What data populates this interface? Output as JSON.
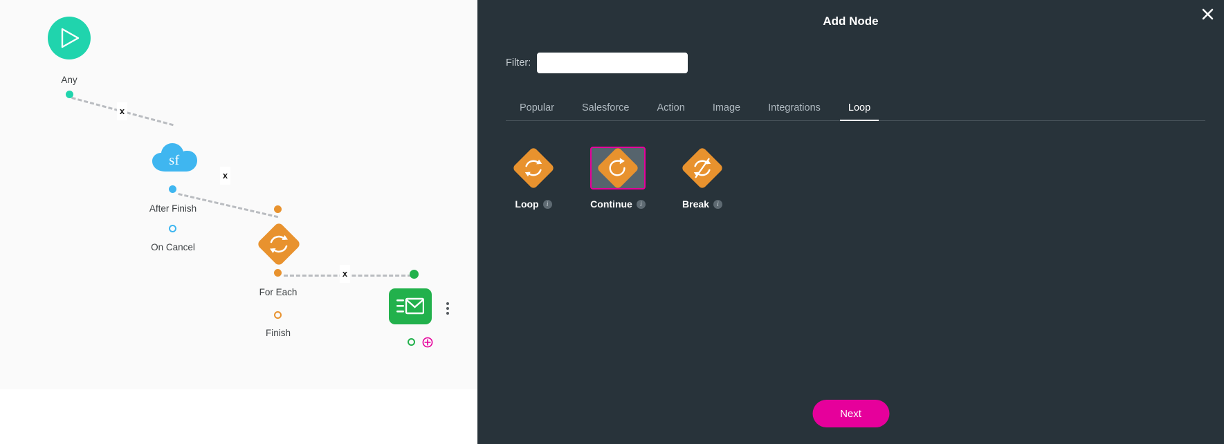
{
  "canvas": {
    "nodes": [
      {
        "id": "any",
        "label": "Any",
        "icon": "play-icon",
        "color": "#20d4ad"
      },
      {
        "id": "salesforce",
        "label": "",
        "icon": "salesforce-cloud-icon",
        "badge": "sf",
        "color": "#3fb6f0"
      },
      {
        "id": "foreach",
        "label": "For Each",
        "icon": "loop-icon",
        "color": "#e8922e"
      },
      {
        "id": "email",
        "label": "",
        "icon": "email-icon",
        "color": "#22b14c"
      }
    ],
    "ports": [
      {
        "label": "",
        "owner": "any",
        "kind": "solid",
        "color": "#20d4ad"
      },
      {
        "label": "After Finish",
        "owner": "salesforce",
        "kind": "solid",
        "color": "#3fb6f0"
      },
      {
        "label": "On Cancel",
        "owner": "salesforce",
        "kind": "hollow",
        "color": "#3fb6f0"
      },
      {
        "label": "For Each",
        "owner": "foreach",
        "kind": "solid",
        "color": "#e8922e"
      },
      {
        "label": "Finish",
        "owner": "foreach",
        "kind": "hollow",
        "color": "#e8922e"
      }
    ],
    "connector_delete_label": "x",
    "email_add_label": "+"
  },
  "panel": {
    "title": "Add Node",
    "close_icon": "close-icon",
    "filter": {
      "label": "Filter:",
      "value": "",
      "placeholder": ""
    },
    "tabs": [
      {
        "label": "Popular",
        "active": false
      },
      {
        "label": "Salesforce",
        "active": false
      },
      {
        "label": "Action",
        "active": false
      },
      {
        "label": "Image",
        "active": false
      },
      {
        "label": "Integrations",
        "active": false
      },
      {
        "label": "Loop",
        "active": true
      }
    ],
    "cards": [
      {
        "label": "Loop",
        "icon": "loop-refresh-icon",
        "info": "i",
        "selected": false
      },
      {
        "label": "Continue",
        "icon": "continue-arrow-icon",
        "info": "i",
        "selected": true
      },
      {
        "label": "Break",
        "icon": "break-slash-icon",
        "info": "i",
        "selected": false
      }
    ],
    "next_label": "Next",
    "accent_color": "#e6009b",
    "panel_bg": "#28333a"
  }
}
